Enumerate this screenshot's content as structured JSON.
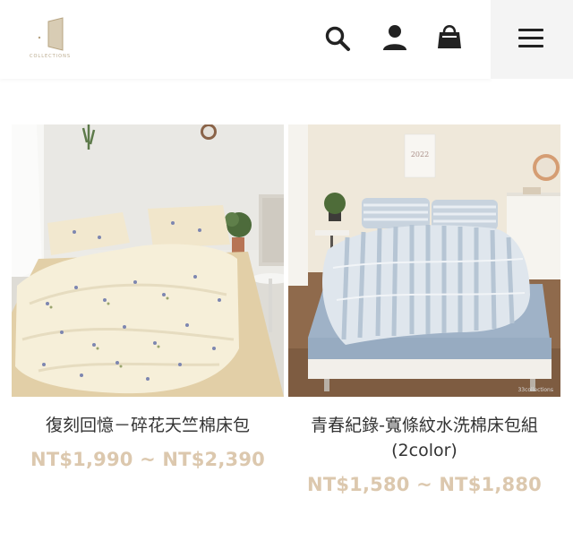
{
  "header": {
    "logo_text": "COLLECTIONS",
    "icons": [
      "search-icon",
      "account-icon",
      "shopping-bag-icon",
      "menu-icon"
    ]
  },
  "products": [
    {
      "title": "復刻回憶－碎花天竺棉床包",
      "price": "NT$1,990 ~ NT$2,390"
    },
    {
      "title": "青春紀錄-寬條紋水洗棉床包組",
      "title_line2": "(2color)",
      "price": "NT$1,580 ~ NT$1,880",
      "calendar_text": "2022",
      "watermark": "33collections"
    }
  ],
  "colors": {
    "price": "#dcc8ae",
    "title": "#333333",
    "icon": "#222222"
  }
}
